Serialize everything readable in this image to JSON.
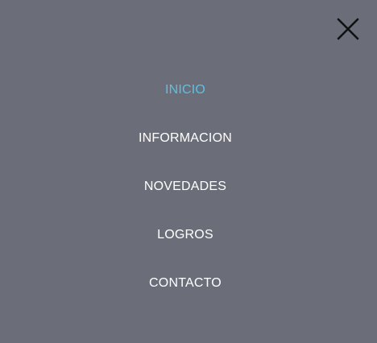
{
  "overlay": {
    "background": "#6b6e78",
    "close_icon": "close-icon"
  },
  "menu": {
    "active_color": "#5bc0e4",
    "items": [
      {
        "label": "INICIO",
        "active": true
      },
      {
        "label": "INFORMACION",
        "active": false
      },
      {
        "label": "NOVEDADES",
        "active": false
      },
      {
        "label": "LOGROS",
        "active": false
      },
      {
        "label": "CONTACTO",
        "active": false
      }
    ]
  }
}
